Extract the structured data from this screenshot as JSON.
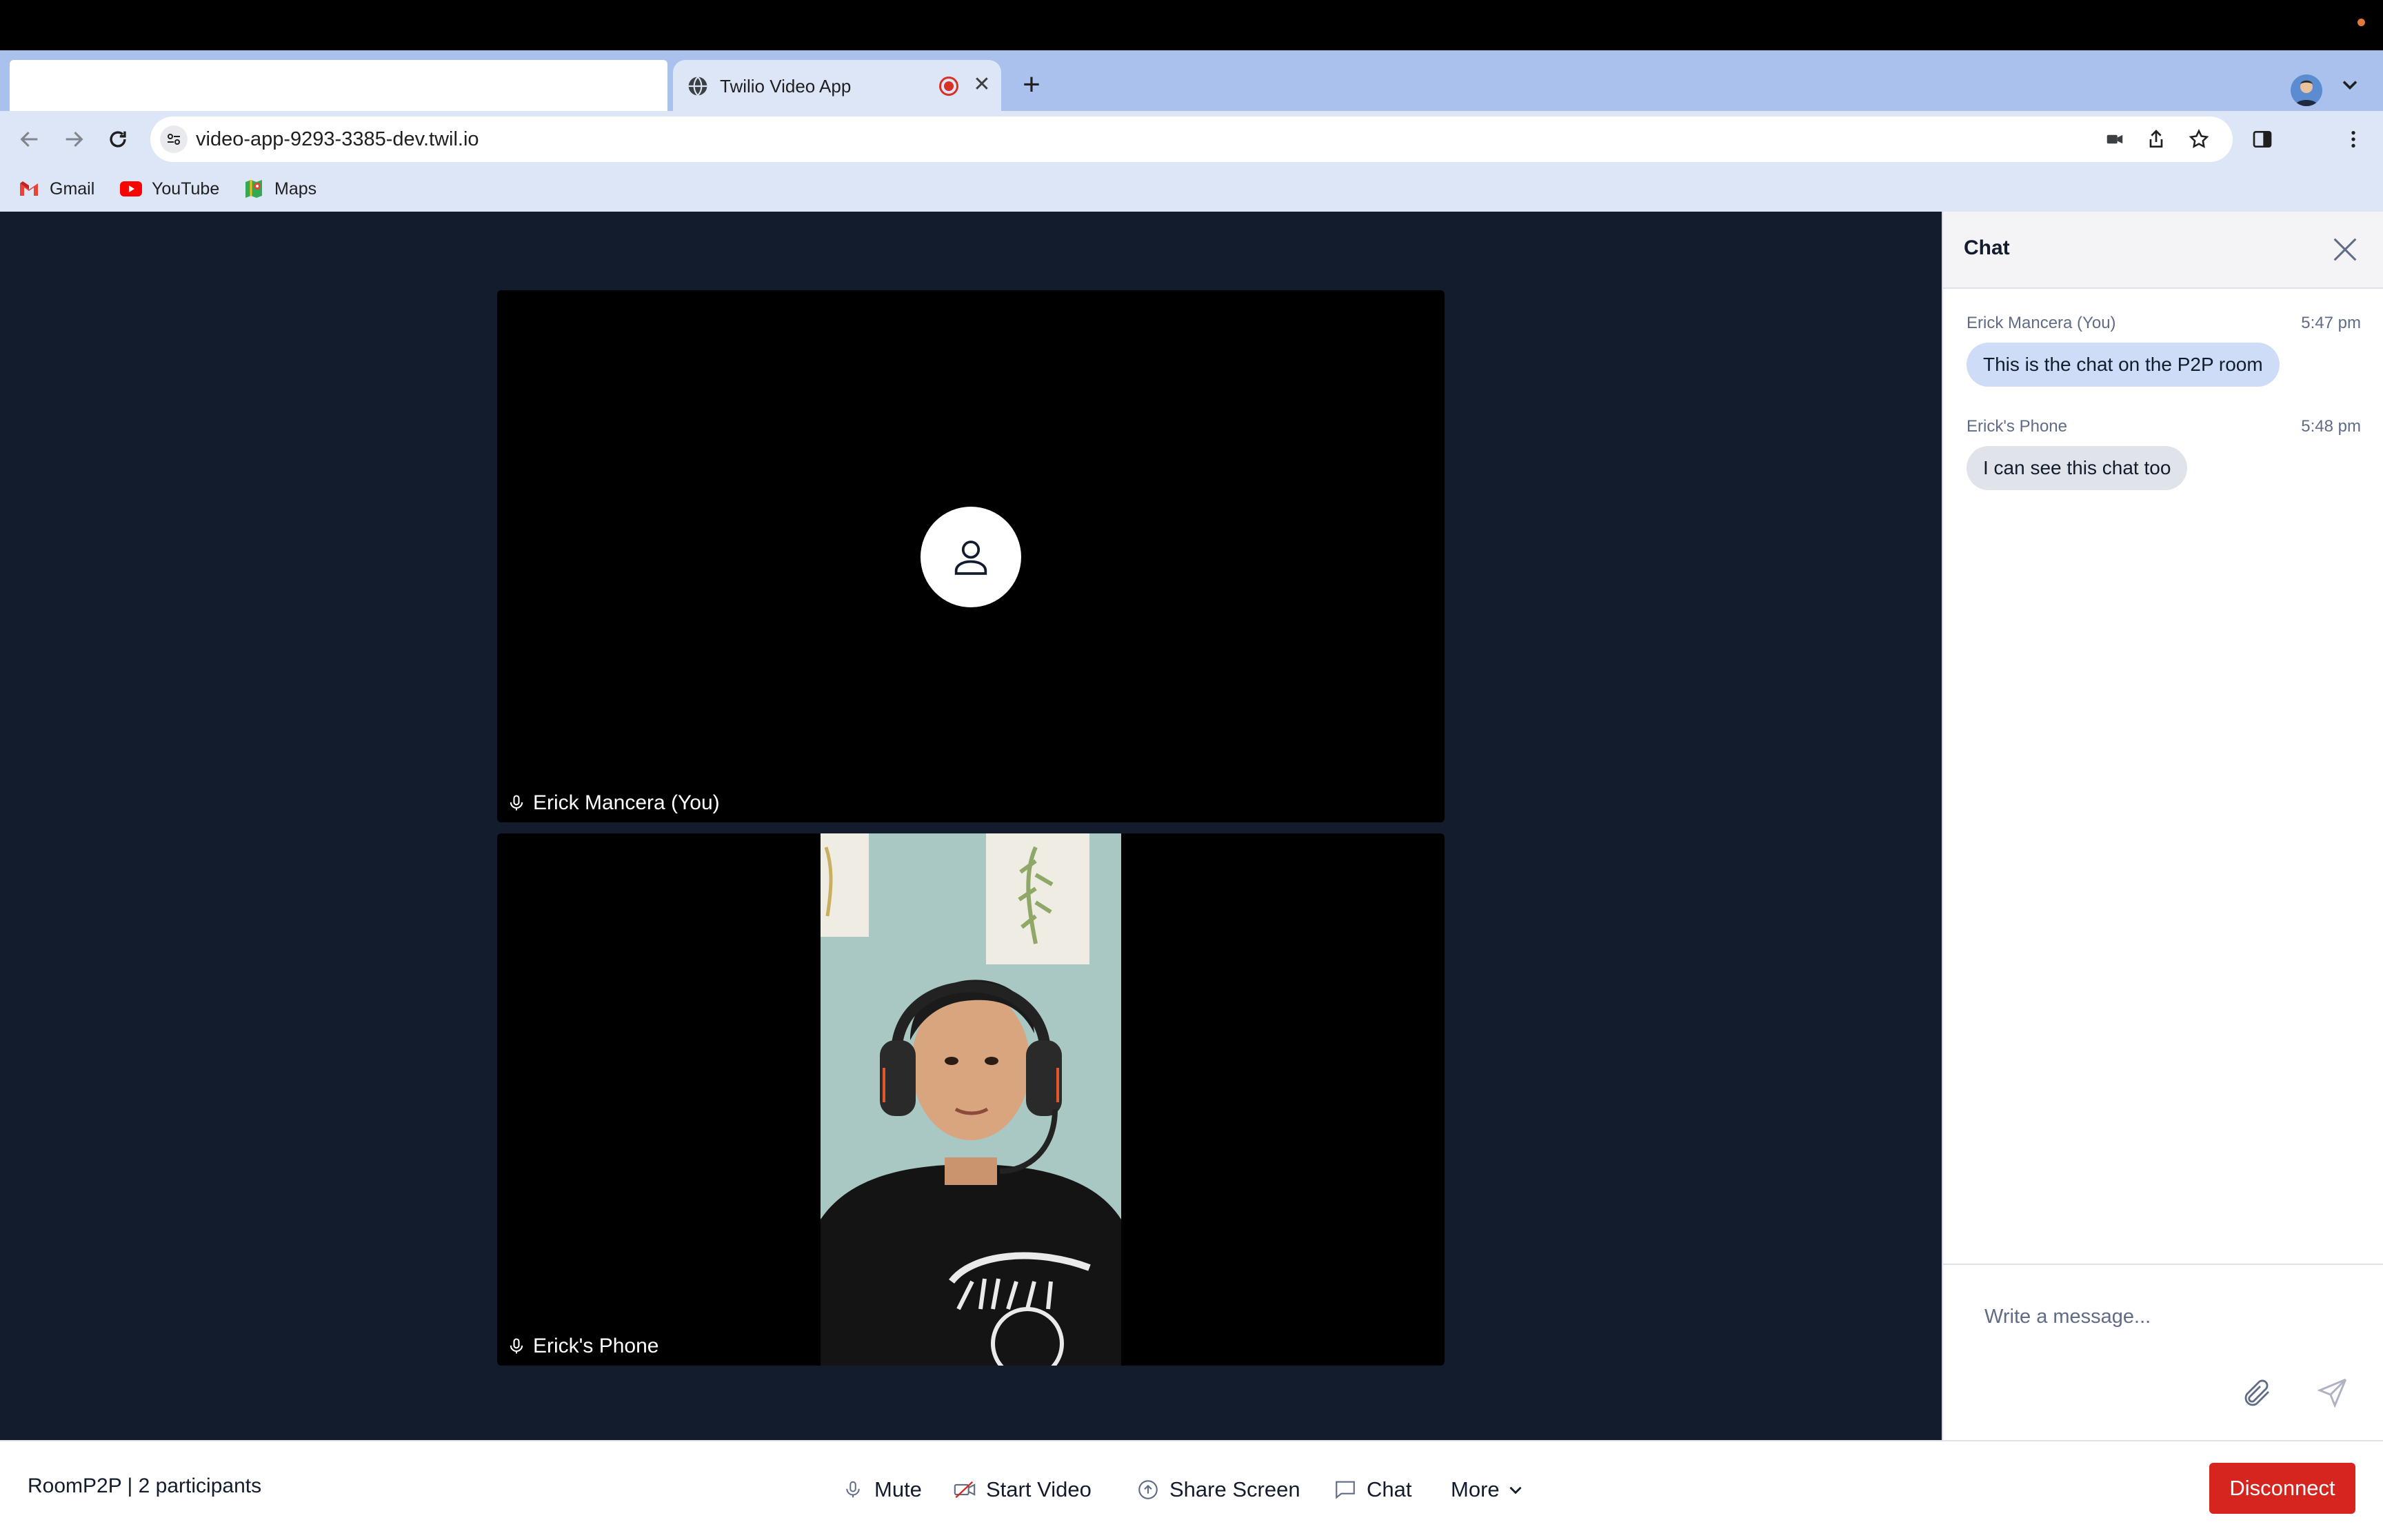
{
  "browser": {
    "tab": {
      "title": "Twilio Video App"
    },
    "address_bar": {
      "url": "video-app-9293-3385-dev.twil.io"
    },
    "bookmarks": [
      {
        "label": "Gmail"
      },
      {
        "label": "YouTube"
      },
      {
        "label": "Maps"
      }
    ]
  },
  "participants": [
    {
      "name": "Erick Mancera (You)",
      "video": "off"
    },
    {
      "name": "Erick's Phone",
      "video": "on"
    }
  ],
  "chat": {
    "title": "Chat",
    "messages": [
      {
        "author": "Erick Mancera (You)",
        "time": "5:47 pm",
        "text": "This is the chat on the P2P room",
        "mine": true
      },
      {
        "author": "Erick's Phone",
        "time": "5:48 pm",
        "text": "I can see this chat too",
        "mine": false
      }
    ],
    "input_placeholder": "Write a message..."
  },
  "menubar": {
    "room_info": "RoomP2P | 2 participants",
    "mute_label": "Mute",
    "video_label": "Start Video",
    "share_label": "Share Screen",
    "chat_label": "Chat",
    "more_label": "More",
    "disconnect_label": "Disconnect"
  },
  "colors": {
    "stage_bg": "#121c2d",
    "disconnect": "#d6251e",
    "my_bubble": "#cfdcf7",
    "their_bubble": "#e1e3ea"
  }
}
